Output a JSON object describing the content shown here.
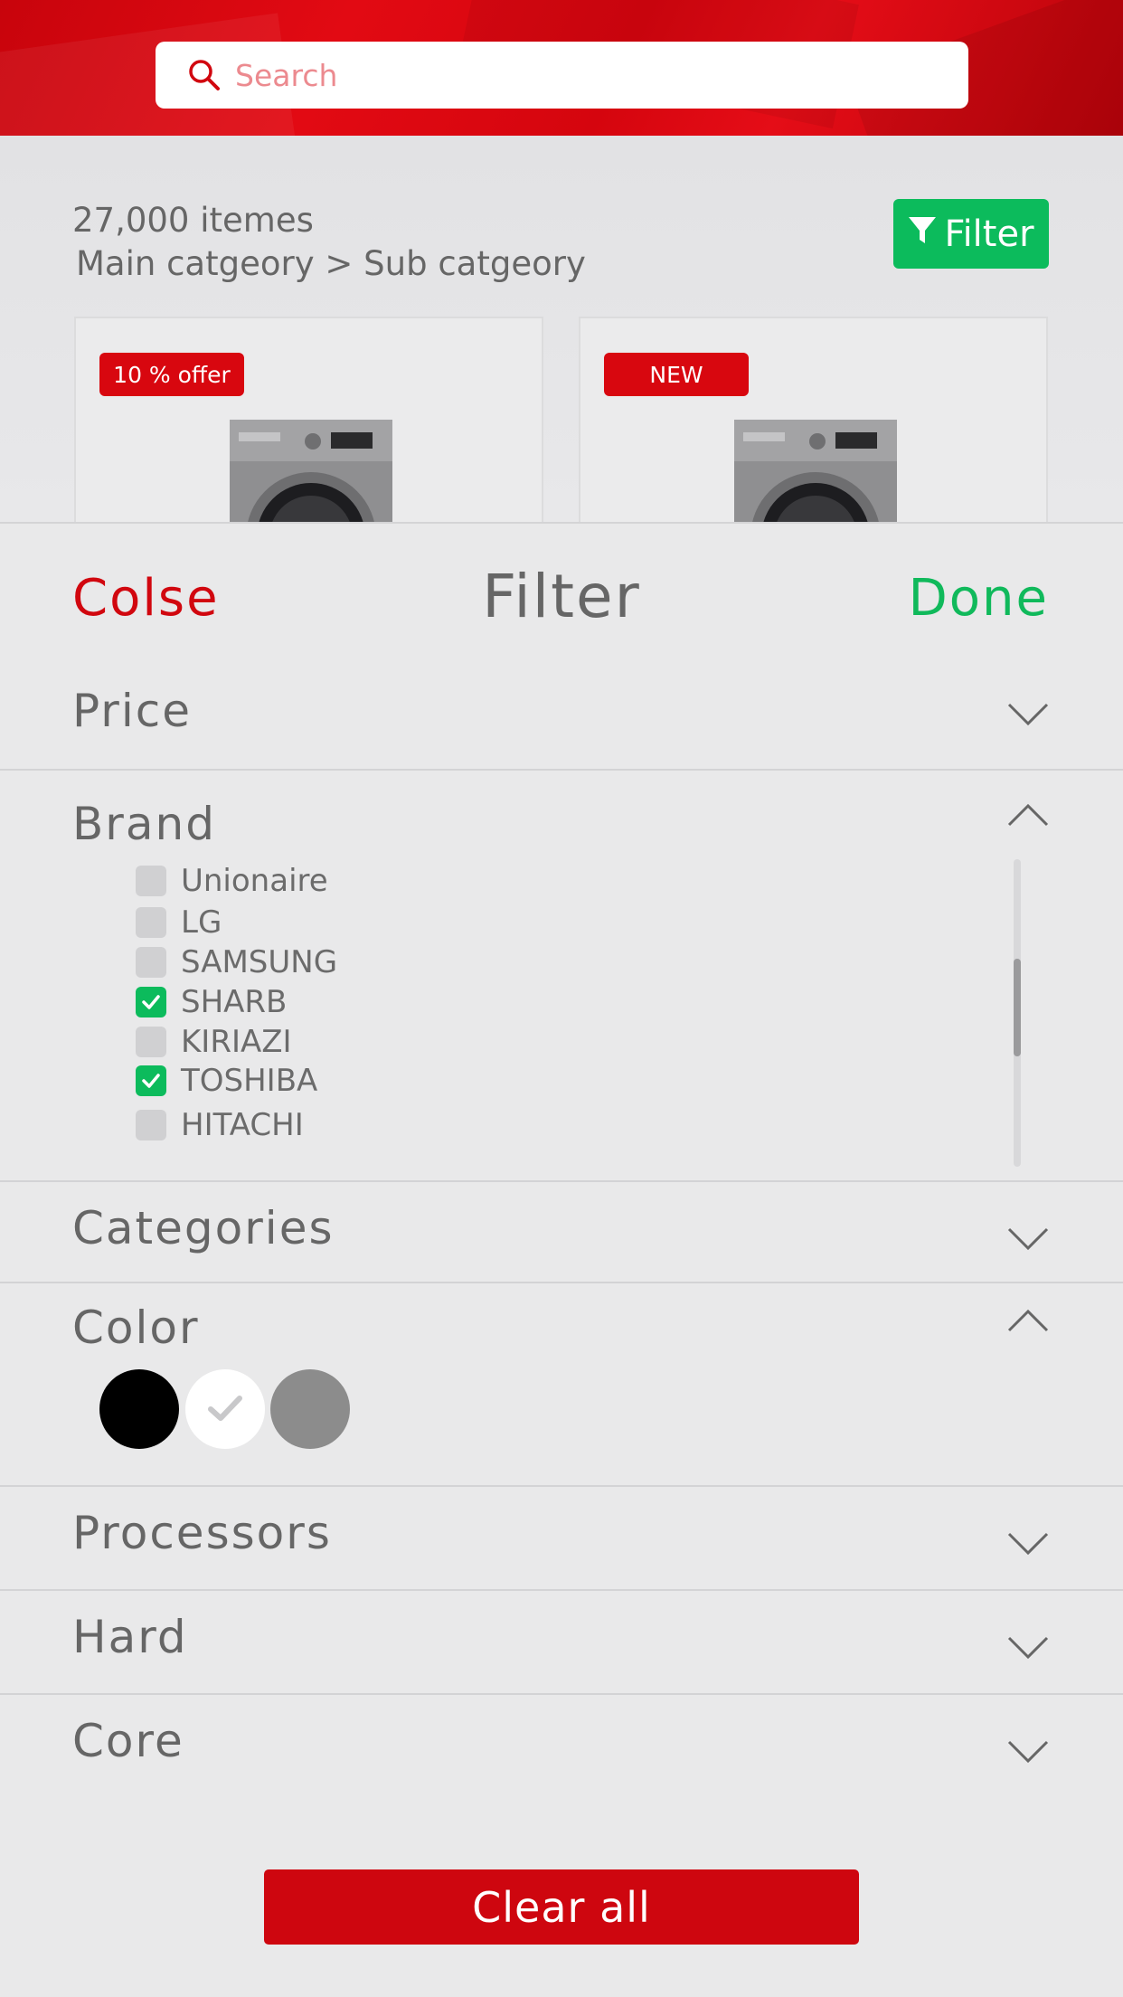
{
  "colors": {
    "accent_red": "#d1070f",
    "accent_green": "#10b95b",
    "background": "#e9e9ea",
    "text": "#6b6b6b"
  },
  "search": {
    "placeholder": "Search",
    "icon": "search-icon"
  },
  "listing": {
    "count": "27,000 itemes",
    "breadcrumb": "Main catgeory > Sub catgeory",
    "filter_label": "Filter",
    "cards": [
      {
        "badge": "10 % offer"
      },
      {
        "badge": "NEW"
      }
    ]
  },
  "filter_sheet": {
    "close_label": "Colse",
    "title": "Filter",
    "done_label": "Done",
    "sections": {
      "price": {
        "label": "Price",
        "expanded": false
      },
      "brand": {
        "label": "Brand",
        "expanded": true,
        "items": [
          {
            "label": "Unionaire",
            "checked": false
          },
          {
            "label": "LG",
            "checked": false
          },
          {
            "label": "SAMSUNG",
            "checked": false
          },
          {
            "label": "SHARB",
            "checked": true
          },
          {
            "label": "KIRIAZI",
            "checked": false
          },
          {
            "label": "TOSHIBA",
            "checked": true
          },
          {
            "label": "HITACHI",
            "checked": false
          }
        ]
      },
      "categories": {
        "label": "Categories",
        "expanded": false
      },
      "color": {
        "label": "Color",
        "expanded": true,
        "swatches": [
          {
            "color": "#000000",
            "selected": false
          },
          {
            "color": "#ffffff",
            "selected": true
          },
          {
            "color": "#8c8c8c",
            "selected": false
          }
        ]
      },
      "processors": {
        "label": "Processors",
        "expanded": false
      },
      "hard": {
        "label": "Hard",
        "expanded": false
      },
      "core": {
        "label": "Core",
        "expanded": false
      }
    },
    "clear_all_label": "Clear all"
  }
}
